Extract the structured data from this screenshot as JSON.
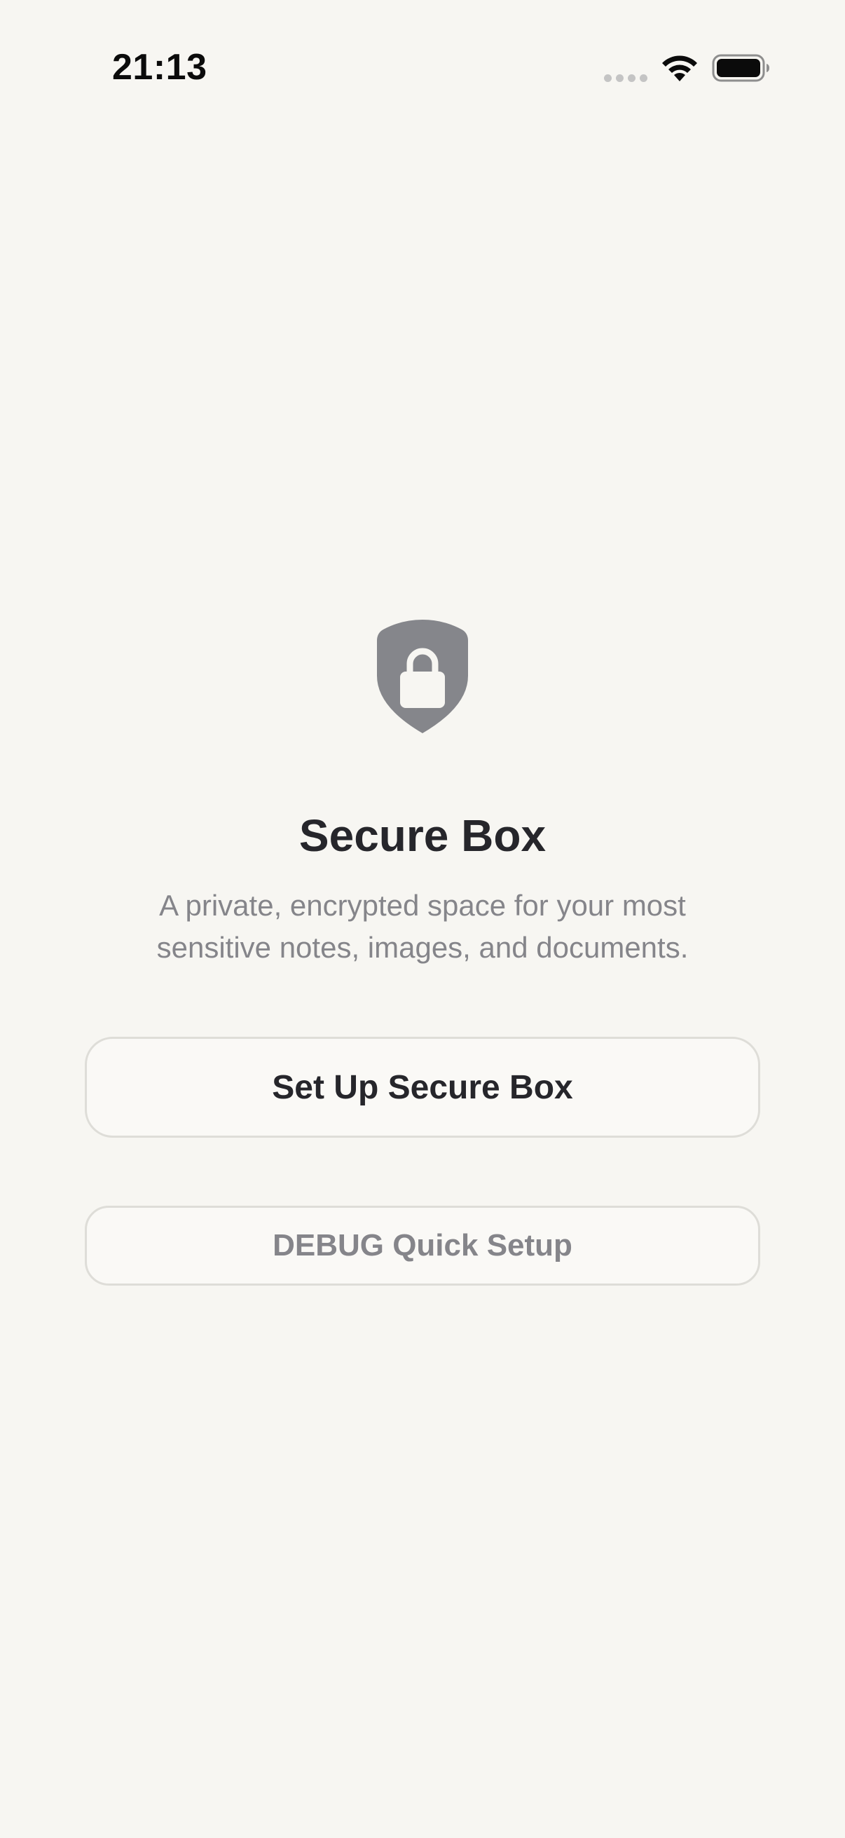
{
  "status_bar": {
    "time": "21:13"
  },
  "icons": {
    "hero": "shield-lock-icon",
    "wifi": "wifi-icon",
    "battery": "battery-icon",
    "signal": "signal-dots-icon"
  },
  "main": {
    "title": "Secure Box",
    "subtitle_lines": [
      "A private, encrypted space for your most",
      "sensitive notes, images, and documents."
    ],
    "setup_button_label": "Set Up Secure Box",
    "debug_button_label": "DEBUG Quick Setup"
  },
  "colors": {
    "background": "#f7f6f2",
    "title": "#26262b",
    "secondary_text": "#85858a",
    "icon_gray": "#85868b",
    "button_border": "#deddd8"
  }
}
